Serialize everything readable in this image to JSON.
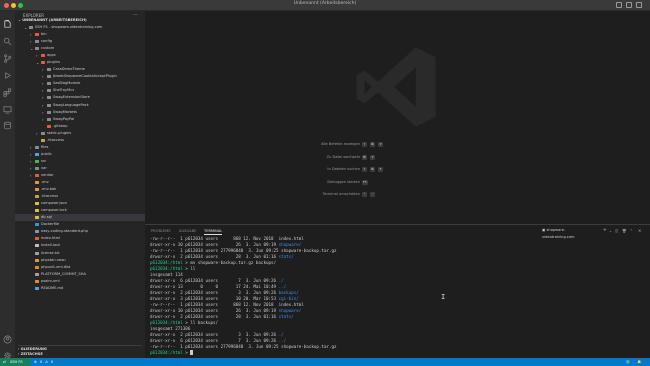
{
  "window": {
    "title": "Unbenannt (Arbeitsbereich)",
    "colors": {
      "close": "#ff5f57",
      "minimize": "#febc2e",
      "maximize": "#28c840"
    }
  },
  "activity_bar": {
    "icons": [
      "files-icon",
      "search-icon",
      "source-control-icon",
      "run-debug-icon",
      "extensions-icon",
      "remote-explorer-icon",
      "database-icon"
    ],
    "bottom_icons": [
      "account-icon",
      "settings-gear-icon"
    ]
  },
  "sidebar": {
    "header": "EXPLORER",
    "section_title": "UNBENANNT (ARBEITSBEREICH)",
    "tree": [
      {
        "label": "SSH FS - shopware-videotraining.com",
        "depth": 1,
        "chevron": "open",
        "icon": "folder-remote"
      },
      {
        "label": "bin",
        "depth": 2,
        "chevron": "closed",
        "icon": "folder-red"
      },
      {
        "label": "config",
        "depth": 2,
        "chevron": "closed",
        "icon": "folder"
      },
      {
        "label": "custom",
        "depth": 2,
        "chevron": "open",
        "icon": "folder"
      },
      {
        "label": "apps",
        "depth": 3,
        "chevron": "closed",
        "icon": "folder-red"
      },
      {
        "label": "plugins",
        "depth": 3,
        "chevron": "open",
        "icon": "folder-red"
      },
      {
        "label": "CasaDemoTheme",
        "depth": 4,
        "chevron": "closed",
        "icon": "folder"
      },
      {
        "label": "JkwebShopwareCookieAcceptPlugin",
        "depth": 4,
        "chevron": "closed",
        "icon": "folder"
      },
      {
        "label": "SasBlogModule",
        "depth": 4,
        "chevron": "closed",
        "icon": "folder"
      },
      {
        "label": "SheTroyMcs",
        "depth": 4,
        "chevron": "closed",
        "icon": "folder"
      },
      {
        "label": "SwagExtensionStore",
        "depth": 4,
        "chevron": "closed",
        "icon": "folder"
      },
      {
        "label": "SwagLanguagePack",
        "depth": 4,
        "chevron": "closed",
        "icon": "folder"
      },
      {
        "label": "SwagMarkets",
        "depth": 4,
        "chevron": "closed",
        "icon": "folder"
      },
      {
        "label": "SwagPayPal",
        "depth": 4,
        "chevron": "closed",
        "icon": "folder"
      },
      {
        "label": ".gitkeep",
        "depth": 4,
        "chevron": "",
        "icon": "file-git"
      },
      {
        "label": "static-plugins",
        "depth": 3,
        "chevron": "closed",
        "icon": "folder"
      },
      {
        "label": ".htaccess",
        "depth": 3,
        "chevron": "",
        "icon": "file-config"
      },
      {
        "label": "files",
        "depth": 2,
        "chevron": "closed",
        "icon": "folder"
      },
      {
        "label": "public",
        "depth": 2,
        "chevron": "closed",
        "icon": "folder-blue"
      },
      {
        "label": "src",
        "depth": 2,
        "chevron": "closed",
        "icon": "folder-green"
      },
      {
        "label": "var",
        "depth": 2,
        "chevron": "closed",
        "icon": "folder"
      },
      {
        "label": "vendor",
        "depth": 2,
        "chevron": "closed",
        "icon": "folder-red"
      },
      {
        "label": ".env",
        "depth": 2,
        "chevron": "",
        "icon": "file-config"
      },
      {
        "label": ".env.bak",
        "depth": 2,
        "chevron": "",
        "icon": "file-config"
      },
      {
        "label": ".htaccess",
        "depth": 2,
        "chevron": "",
        "icon": "file-config"
      },
      {
        "label": "composer.json",
        "depth": 2,
        "chevron": "",
        "icon": "file-json"
      },
      {
        "label": "composer.lock",
        "depth": 2,
        "chevron": "",
        "icon": "file-json"
      },
      {
        "label": "db.sql",
        "depth": 2,
        "chevron": "",
        "icon": "file-db",
        "selected": true
      },
      {
        "label": "Dockerfile",
        "depth": 2,
        "chevron": "",
        "icon": "file-docker"
      },
      {
        "label": "easy-coding-standard.php",
        "depth": 2,
        "chevron": "",
        "icon": "file-php"
      },
      {
        "label": "index.html",
        "depth": 2,
        "chevron": "",
        "icon": "file-html"
      },
      {
        "label": "install.lock",
        "depth": 2,
        "chevron": "",
        "icon": "file-lock"
      },
      {
        "label": "license.txt",
        "depth": 2,
        "chevron": "",
        "icon": "file-text"
      },
      {
        "label": "phpstan.neon",
        "depth": 2,
        "chevron": "",
        "icon": "file-config"
      },
      {
        "label": "phpunit.xml.dist",
        "depth": 2,
        "chevron": "",
        "icon": "file-xml"
      },
      {
        "label": "PLATFORM_COMMIT_SHA",
        "depth": 2,
        "chevron": "",
        "icon": "file-text"
      },
      {
        "label": "psalm.xml",
        "depth": 2,
        "chevron": "",
        "icon": "file-xml"
      },
      {
        "label": "README.md",
        "depth": 2,
        "chevron": "",
        "icon": "file-md"
      }
    ],
    "outline_label": "GLIEDERUNG",
    "timeline_label": "ZEITACHSE"
  },
  "welcome": {
    "shortcuts": [
      {
        "label": "Alle Befehle anzeigen",
        "keys": [
          "⇧",
          "⌘",
          "P"
        ]
      },
      {
        "label": "Zu Datei wechseln",
        "keys": [
          "⌘",
          "P"
        ]
      },
      {
        "label": "In Dateien suchen",
        "keys": [
          "⇧",
          "⌘",
          "F"
        ]
      },
      {
        "label": "Debuggen starten",
        "keys": [
          "F5"
        ]
      },
      {
        "label": "Terminal umschalten",
        "keys": [
          "⌃",
          "`"
        ]
      }
    ]
  },
  "panel": {
    "tabs": [
      "PROBLEME",
      "AUSGABE",
      "TERMINAL"
    ],
    "active_tab": "TERMINAL",
    "terminal_name": "shopware-videotraining.com"
  },
  "terminal": {
    "lines": [
      [
        [
          "-rw-r--r--  1 p612034 users      868 12. Nov 2018  index.html",
          ""
        ]
      ],
      [
        [
          "drwxr-xr-x 10 p612034 users       26  3. Jun 09:19 ",
          ""
        ],
        [
          "shopware/",
          "blue"
        ]
      ],
      [
        [
          "-rw-r--r--  1 p612034 users 277996848  3. Jun 09:25 shopware-backup.tar.gz",
          ""
        ]
      ],
      [
        [
          "drwxr-xr-x  2 p612034 users       28  3. Jun 01:16 ",
          ""
        ],
        [
          "stats/",
          "blue"
        ]
      ],
      [
        [
          "p612034:/html",
          "green"
        ],
        [
          " > mv shopware-backup.tar.gz backups/",
          ""
        ]
      ],
      [
        [
          "p612034:/html",
          "green"
        ],
        [
          " > ll",
          ""
        ]
      ],
      [
        [
          "insgesamt 114",
          ""
        ]
      ],
      [
        [
          "drwxr-xr-x  6 p612034 users        7  3. Jun 09:26 ",
          ""
        ],
        [
          "./",
          "blue"
        ]
      ],
      [
        [
          "drwxr-xr-x 13       0     0       17 24. Mai 10:49 ",
          ""
        ],
        [
          "../",
          "blue"
        ]
      ],
      [
        [
          "drwxr-xr-x  2 p612034 users        3  3. Jun 09:26 ",
          ""
        ],
        [
          "backups/",
          "blue"
        ]
      ],
      [
        [
          "drwxr-xr-x  3 p612034 users       10 20. Mar 10:53 ",
          ""
        ],
        [
          "cgi-bin/",
          "blue"
        ]
      ],
      [
        [
          "-rw-r--r--  1 p612034 users      868 12. Nov 2018  index.html",
          ""
        ]
      ],
      [
        [
          "drwxr-xr-x 10 p612034 users       26  3. Jun 09:19 ",
          ""
        ],
        [
          "shopware/",
          "blue"
        ]
      ],
      [
        [
          "drwxr-xr-x  2 p612034 users       28  3. Jun 01:16 ",
          ""
        ],
        [
          "stats/",
          "blue"
        ]
      ],
      [
        [
          "p612034:/html",
          "green"
        ],
        [
          " > ll backups/",
          ""
        ]
      ],
      [
        [
          "insgesamt 271306",
          ""
        ]
      ],
      [
        [
          "drwxr-xr-x  2 p612034 users        3  3. Jun 09:26 ",
          ""
        ],
        [
          "./",
          "blue"
        ]
      ],
      [
        [
          "drwxr-xr-x  6 p612034 users        7  3. Jun 09:26 ",
          ""
        ],
        [
          "../",
          "blue"
        ]
      ],
      [
        [
          "-rw-r--r--  1 p612034 users 277996848  3. Jun 09:25 shopware-backup.tar.gz",
          ""
        ]
      ],
      [
        [
          "p612034:/html",
          "green"
        ],
        [
          " > ",
          ""
        ]
      ]
    ]
  },
  "statusbar": {
    "remote": "SSH FS",
    "errors": "0",
    "warnings": "0",
    "colors": {
      "bar": "#007acc",
      "remote_bg": "#16825d"
    }
  }
}
